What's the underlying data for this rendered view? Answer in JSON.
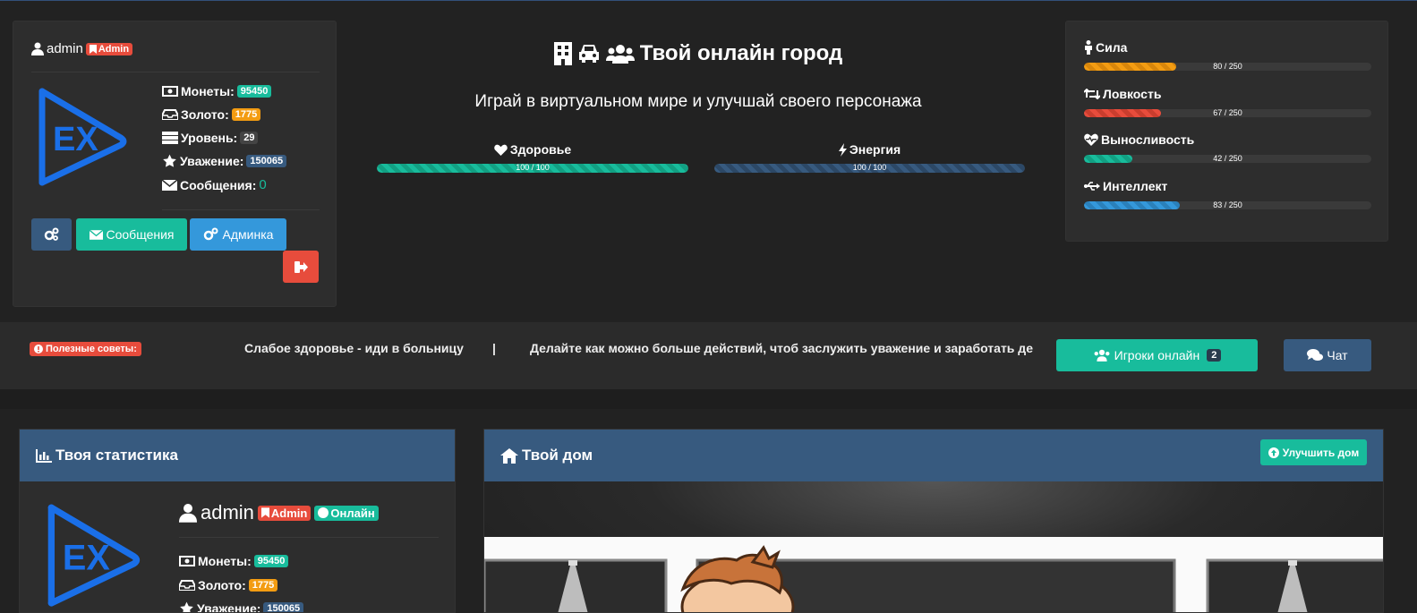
{
  "user": {
    "name": "admin",
    "role_badge": "Admin",
    "online_badge": "Онлайн",
    "stats": [
      {
        "icon": "money-icon",
        "label": "Монеты:",
        "value": "95450",
        "badge": "green"
      },
      {
        "icon": "inbox-icon",
        "label": "Золото:",
        "value": "1775",
        "badge": "orange"
      },
      {
        "icon": "server-icon",
        "label": "Уровень:",
        "value": "29",
        "badge": "gray"
      },
      {
        "icon": "star-icon",
        "label": "Уважение:",
        "value": "150065",
        "badge": "blue"
      },
      {
        "icon": "envelope-icon",
        "label": "Сообщения:",
        "value": "0",
        "badge": "none"
      }
    ]
  },
  "buttons": {
    "messages": "Сообщения",
    "admin": "Админка",
    "upgrade_home": "Улучшить дом",
    "players_online": "Игроки онлайн",
    "players_online_count": "2",
    "chat": "Чат"
  },
  "header": {
    "title": "Твой онлайн город",
    "subtitle": "Играй в виртуальном мире и улучшай своего персонажа"
  },
  "vitals": [
    {
      "label": "Здоровье",
      "value": 100,
      "max": 100,
      "text": "100 / 100",
      "color": "#18bc9c"
    },
    {
      "label": "Энергия",
      "value": 100,
      "max": 100,
      "text": "100 / 100",
      "color": "#375a7f"
    }
  ],
  "attributes": [
    {
      "label": "Сила",
      "value": 80,
      "max": 250,
      "text": "80 / 250",
      "color": "#f39c12"
    },
    {
      "label": "Ловкость",
      "value": 67,
      "max": 250,
      "text": "67 / 250",
      "color": "#e74c3c"
    },
    {
      "label": "Выносливость",
      "value": 42,
      "max": 250,
      "text": "42 / 250",
      "color": "#18bc9c"
    },
    {
      "label": "Интеллект",
      "value": 83,
      "max": 250,
      "text": "83 / 250",
      "color": "#3498db"
    }
  ],
  "tips": {
    "label": "Полезные советы:",
    "items": [
      "Слабое здоровье - иди в больницу",
      "|",
      "Делайте как можно больше действий, чтоб заслужить уважение и заработать де"
    ]
  },
  "sections": {
    "stats_title": "Твоя статистика",
    "home_title": "Твой дом"
  },
  "colors": {
    "primary": "#375a7f",
    "success": "#18bc9c",
    "danger": "#e74c3c",
    "warning": "#f39c12",
    "info": "#3498db"
  }
}
